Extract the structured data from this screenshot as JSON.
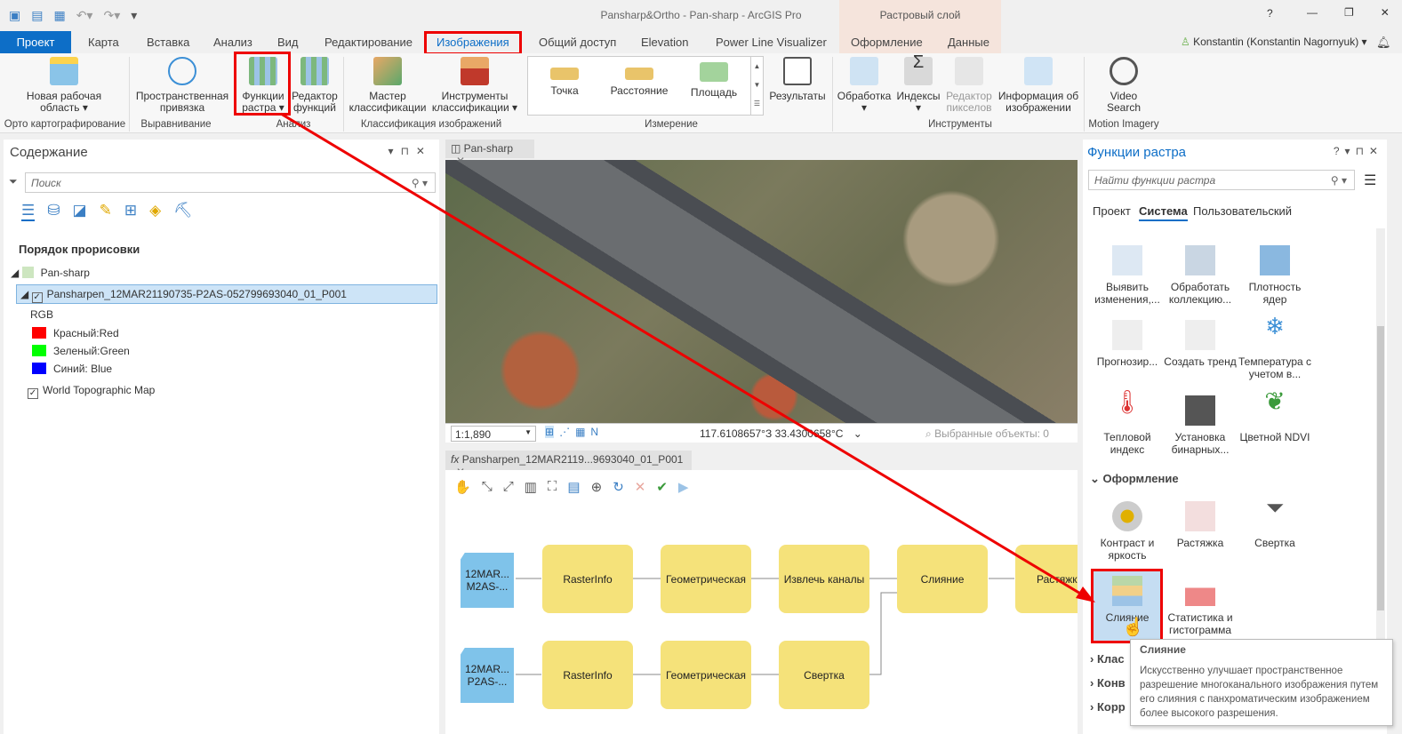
{
  "window": {
    "title": "Pansharp&Ortho - Pan-sharp - ArcGIS Pro",
    "context_tab_group": "Растровый слой",
    "help": "?",
    "user": "Konstantin (Konstantin Nagornyuk)"
  },
  "tabs": [
    "Проект",
    "Карта",
    "Вставка",
    "Анализ",
    "Вид",
    "Редактирование",
    "Изображения",
    "Общий доступ",
    "Elevation",
    "Power Line Visualizer",
    "Оформление",
    "Данные"
  ],
  "ribbon": {
    "buttons": [
      {
        "label": "Новая рабочая область ▾"
      },
      {
        "label": "Пространственная привязка"
      },
      {
        "label": "Функции растра ▾"
      },
      {
        "label": "Редактор функций"
      },
      {
        "label": "Мастер классификации"
      },
      {
        "label": "Инструменты классификации ▾"
      },
      {
        "label": "Точка"
      },
      {
        "label": "Расстояние"
      },
      {
        "label": "Площадь"
      },
      {
        "label": "Результаты"
      },
      {
        "label": "Обработка ▾"
      },
      {
        "label": "Индексы ▾"
      },
      {
        "label": "Редактор пикселов"
      },
      {
        "label": "Информация об изображении"
      },
      {
        "label": "Video Search"
      }
    ],
    "groups": [
      "Орто картографирование",
      "Выравнивание",
      "Анализ",
      "Классификация изображений",
      "Измерение",
      "Инструменты",
      "Motion Imagery"
    ]
  },
  "contents": {
    "title": "Содержание",
    "search_placeholder": "Поиск",
    "drawing_order": "Порядок прорисовки",
    "map": "Pan-sharp",
    "layer": "Pansharpen_12MAR21190735-P2AS-052799693040_01_P001",
    "rgb": "RGB",
    "bands": [
      {
        "label": "Красный:Red",
        "color": "#ff0000"
      },
      {
        "label": "Зеленый:Green",
        "color": "#00ff00"
      },
      {
        "label": "Синий: Blue",
        "color": "#0000ff"
      }
    ],
    "basemap": "World Topographic Map"
  },
  "map_view": {
    "tab": "Pan-sharp",
    "scale": "1:1,890",
    "coords": "117.6108657°З 33.4300658°С",
    "selected": "Выбранные объекты: 0"
  },
  "model": {
    "tab": "Pansharpen_12MAR2119...9693040_01_P001",
    "sources": [
      "12MAR... M2AS-...",
      "12MAR... P2AS-..."
    ],
    "row1": [
      "RasterInfo",
      "Геометрическая",
      "Извлечь каналы",
      "Слияние",
      "Растяжка"
    ],
    "row2": [
      "RasterInfo",
      "Геометрическая",
      "Свертка"
    ]
  },
  "raster_functions": {
    "title": "Функции растра",
    "search_placeholder": "Найти функции растра",
    "tabs": [
      "Проект",
      "Система",
      "Пользовательский"
    ],
    "functions": [
      "Выявить изменения,...",
      "Обработать коллекцию...",
      "Плотность ядер",
      "Прогнозир...",
      "Создать тренд",
      "Температура с учетом в...",
      "Тепловой индекс",
      "Установка бинарных...",
      "Цветной NDVI"
    ],
    "section": "Оформление",
    "appearance": [
      "Контраст и яркость",
      "Растяжка",
      "Свертка",
      "Слияние",
      "Статистика и гистограмма"
    ],
    "categories": [
      "Клас",
      "Конв",
      "Корр"
    ],
    "tooltip": {
      "title": "Слияние",
      "text": "Искусственно улучшает пространственное разрешение многоканального изображения путем его слияния с панхроматическим изображением более высокого разрешения."
    }
  }
}
